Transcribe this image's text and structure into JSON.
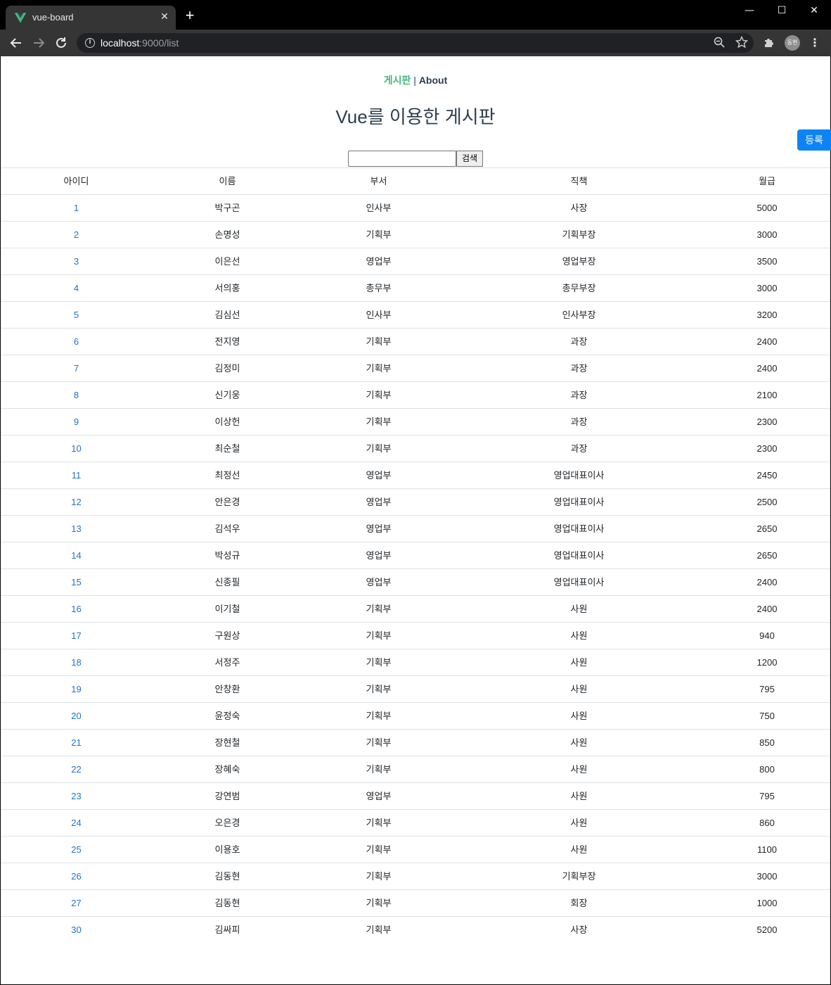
{
  "browser": {
    "tab_title": "vue-board",
    "tab_close": "✕",
    "new_tab": "+",
    "url_host": "localhost",
    "url_rest": ":9000/list",
    "profile_initials": "동현",
    "window": {
      "minimize": "—",
      "maximize": "☐",
      "close": "✕"
    },
    "icons": {
      "back": "back-arrow-icon",
      "forward": "forward-arrow-icon",
      "reload": "reload-icon",
      "info": "info-icon",
      "zoom": "zoom-out-icon",
      "bookmark": "star-icon",
      "extensions": "puzzle-icon",
      "menu": "kebab-menu-icon"
    },
    "colors": {
      "vue_green": "#42b983",
      "vue_dark": "#35495e"
    }
  },
  "nav": {
    "board_label": "게시판",
    "separator": "|",
    "about_label": "About"
  },
  "page": {
    "title": "Vue를 이용한 게시판",
    "register_label": "등록",
    "search_button": "검색",
    "search_value": ""
  },
  "table": {
    "headers": [
      "아이디",
      "이름",
      "부서",
      "직책",
      "월급"
    ],
    "rows": [
      [
        "1",
        "박구곤",
        "인사부",
        "사장",
        "5000"
      ],
      [
        "2",
        "손명성",
        "기획부",
        "기획부장",
        "3000"
      ],
      [
        "3",
        "이은선",
        "영업부",
        "영업부장",
        "3500"
      ],
      [
        "4",
        "서의홍",
        "총무부",
        "총무부장",
        "3000"
      ],
      [
        "5",
        "김심선",
        "인사부",
        "인사부장",
        "3200"
      ],
      [
        "6",
        "전지영",
        "기획부",
        "과장",
        "2400"
      ],
      [
        "7",
        "김정미",
        "기획부",
        "과장",
        "2400"
      ],
      [
        "8",
        "신기웅",
        "기획부",
        "과장",
        "2100"
      ],
      [
        "9",
        "이상헌",
        "기획부",
        "과장",
        "2300"
      ],
      [
        "10",
        "최순철",
        "기획부",
        "과장",
        "2300"
      ],
      [
        "11",
        "최정선",
        "영업부",
        "영업대표이사",
        "2450"
      ],
      [
        "12",
        "안은경",
        "영업부",
        "영업대표이사",
        "2500"
      ],
      [
        "13",
        "김석우",
        "영업부",
        "영업대표이사",
        "2650"
      ],
      [
        "14",
        "박성규",
        "영업부",
        "영업대표이사",
        "2650"
      ],
      [
        "15",
        "신종필",
        "영업부",
        "영업대표이사",
        "2400"
      ],
      [
        "16",
        "이기철",
        "기획부",
        "사원",
        "2400"
      ],
      [
        "17",
        "구원상",
        "기획부",
        "사원",
        "940"
      ],
      [
        "18",
        "서정주",
        "기획부",
        "사원",
        "1200"
      ],
      [
        "19",
        "안창환",
        "기획부",
        "사원",
        "795"
      ],
      [
        "20",
        "윤정숙",
        "기획부",
        "사원",
        "750"
      ],
      [
        "21",
        "장현철",
        "기획부",
        "사원",
        "850"
      ],
      [
        "22",
        "장혜숙",
        "기획부",
        "사원",
        "800"
      ],
      [
        "23",
        "강연범",
        "영업부",
        "사원",
        "795"
      ],
      [
        "24",
        "오은경",
        "기획부",
        "사원",
        "860"
      ],
      [
        "25",
        "이용호",
        "기획부",
        "사원",
        "1100"
      ],
      [
        "26",
        "김동현",
        "기획부",
        "기획부장",
        "3000"
      ],
      [
        "27",
        "김동현",
        "기획부",
        "회장",
        "1000"
      ],
      [
        "30",
        "김싸피",
        "기획부",
        "사장",
        "5200"
      ]
    ]
  }
}
